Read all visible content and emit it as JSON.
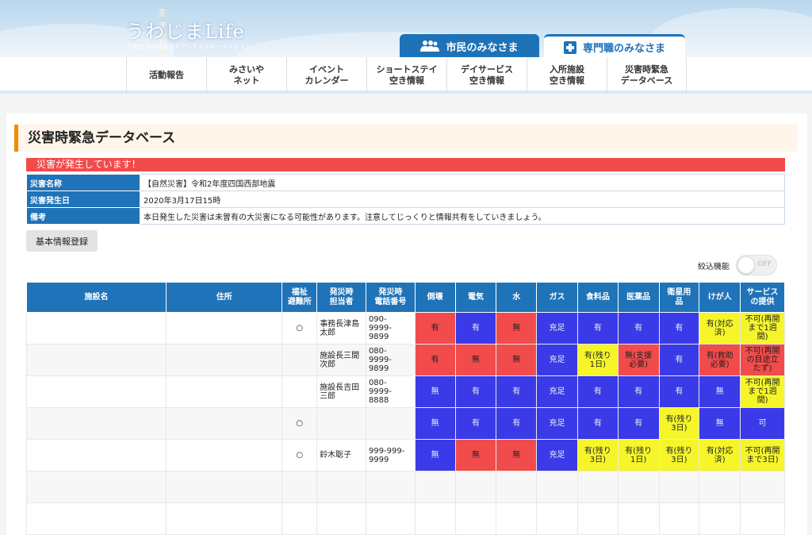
{
  "header": {
    "tagline": "生き活き",
    "site_name": "うわじまLife",
    "site_subtitle": "宇和島市地域包括ケアシステムポータルサイト",
    "tab_citizen": "市民のみなさま",
    "tab_professional": "専門職のみなさま"
  },
  "nav": [
    "活動報告",
    "みさいや\nネット",
    "イベント\nカレンダー",
    "ショートステイ\n空き情報",
    "デイサービス\n空き情報",
    "入所施設\n空き情報",
    "災害時緊急\nデータベース"
  ],
  "page_title": "災害時緊急データベース",
  "alert_text": "災害が発生しています！",
  "info": {
    "disaster_name_label": "災害名称",
    "disaster_name": "【自然災害】令和2年度四国西部地震",
    "date_label": "災害発生日",
    "date": "2020年3月17日15時",
    "note_label": "備考",
    "note": "本日発生した災害は未曽有の大災害になる可能性があります。注意してじっくりと情報共有をしていきましょう。"
  },
  "basic_info_button": "基本情報登録",
  "filter": {
    "label": "絞込機能",
    "toggle_state": "OFF"
  },
  "table": {
    "headers": [
      "施設名",
      "住所",
      "福祉\n避難所",
      "発災時\n担当者",
      "発災時\n電話番号",
      "倒壊",
      "電気",
      "水",
      "ガス",
      "食料品",
      "医薬品",
      "衛星用\n品",
      "けが人",
      "サービス\nの提供"
    ],
    "rows": [
      {
        "shelter": "○",
        "person": "事務長津島\n太郎",
        "phone": "090-\n9999-\n9899",
        "cells": [
          {
            "t": "有",
            "c": "red"
          },
          {
            "t": "有",
            "c": "blue"
          },
          {
            "t": "無",
            "c": "red"
          },
          {
            "t": "充足",
            "c": "blue"
          },
          {
            "t": "有",
            "c": "blue"
          },
          {
            "t": "有",
            "c": "blue"
          },
          {
            "t": "有",
            "c": "blue"
          },
          {
            "t": "有(対応\n済)",
            "c": "yellow"
          },
          {
            "t": "不可(再開\nまで1週\n間)",
            "c": "yellow"
          }
        ]
      },
      {
        "shelter": "",
        "person": "施設長三間\n次郎",
        "phone": "080-\n9999-\n9899",
        "cells": [
          {
            "t": "有",
            "c": "red"
          },
          {
            "t": "無",
            "c": "red"
          },
          {
            "t": "無",
            "c": "red"
          },
          {
            "t": "充足",
            "c": "blue"
          },
          {
            "t": "有(残り\n1日)",
            "c": "yellow"
          },
          {
            "t": "無(支援\n必要)",
            "c": "red"
          },
          {
            "t": "有",
            "c": "blue"
          },
          {
            "t": "有(救助\n必要)",
            "c": "red"
          },
          {
            "t": "不可(再開\nの目途立\nたず)",
            "c": "red"
          }
        ]
      },
      {
        "shelter": "",
        "person": "施設長吉田\n三郎",
        "phone": "080-\n9999-\n8888",
        "cells": [
          {
            "t": "無",
            "c": "blue"
          },
          {
            "t": "有",
            "c": "blue"
          },
          {
            "t": "有",
            "c": "blue"
          },
          {
            "t": "充足",
            "c": "blue"
          },
          {
            "t": "有",
            "c": "blue"
          },
          {
            "t": "有",
            "c": "blue"
          },
          {
            "t": "有",
            "c": "blue"
          },
          {
            "t": "無",
            "c": "blue"
          },
          {
            "t": "不可(再開\nまで1週\n間)",
            "c": "yellow"
          }
        ]
      },
      {
        "shelter": "○",
        "person": "",
        "phone": "",
        "cells": [
          {
            "t": "無",
            "c": "blue"
          },
          {
            "t": "有",
            "c": "blue"
          },
          {
            "t": "有",
            "c": "blue"
          },
          {
            "t": "充足",
            "c": "blue"
          },
          {
            "t": "有",
            "c": "blue"
          },
          {
            "t": "有",
            "c": "blue"
          },
          {
            "t": "有(残り\n3日)",
            "c": "yellow"
          },
          {
            "t": "無",
            "c": "blue"
          },
          {
            "t": "可",
            "c": "blue"
          }
        ]
      },
      {
        "shelter": "○",
        "person": "鈴木聡子",
        "phone": "999-999-\n9999",
        "cells": [
          {
            "t": "無",
            "c": "blue"
          },
          {
            "t": "無",
            "c": "red"
          },
          {
            "t": "無",
            "c": "red"
          },
          {
            "t": "充足",
            "c": "blue"
          },
          {
            "t": "有(残り\n3日)",
            "c": "yellow"
          },
          {
            "t": "有(残り\n1日)",
            "c": "yellow"
          },
          {
            "t": "有(残り\n3日)",
            "c": "yellow"
          },
          {
            "t": "有(対応\n済)",
            "c": "yellow"
          },
          {
            "t": "不可(再開\nまで3日)",
            "c": "yellow"
          }
        ]
      }
    ],
    "empty_rows": 2
  },
  "colors": {
    "red": "#f24b4b",
    "blue": "#3a3ae8",
    "yellow": "#f5f52a",
    "header_blue": "#1f73b8",
    "accent_orange": "#f08c00"
  }
}
